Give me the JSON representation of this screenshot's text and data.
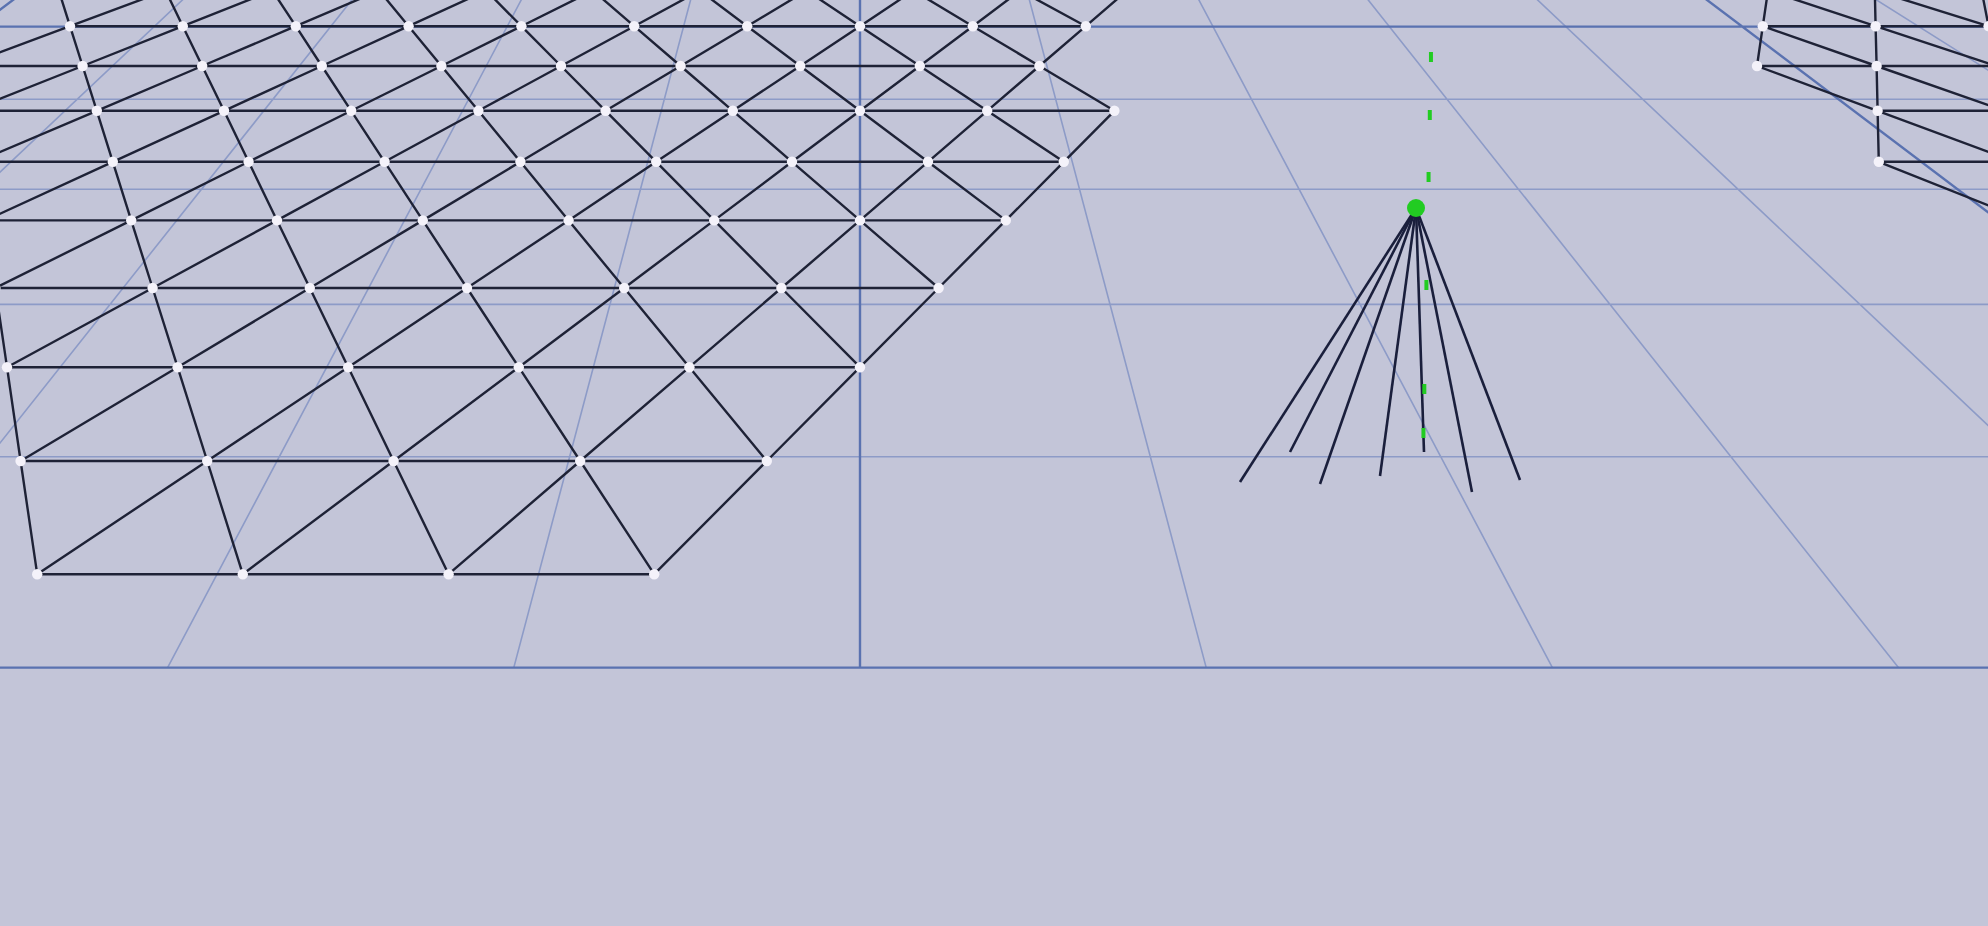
{
  "viewport": {
    "grid_visible": true,
    "selected_vertex": true
  }
}
